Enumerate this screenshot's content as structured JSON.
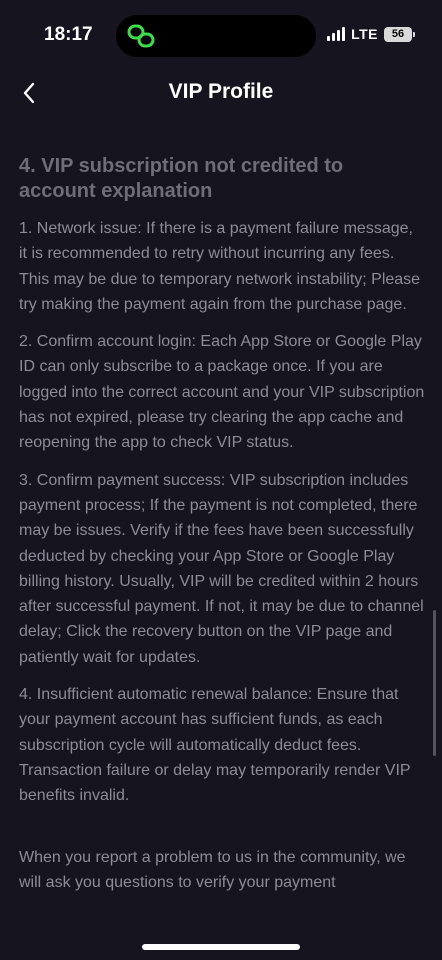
{
  "status_bar": {
    "time": "18:17",
    "network": "LTE",
    "battery": "56"
  },
  "header": {
    "title": "VIP Profile"
  },
  "section": {
    "heading": "4. VIP subscription not credited to account explanation",
    "paragraphs": [
      "1. Network issue: If there is a payment failure message, it is recommended to retry without incurring any fees. This may be due to temporary network instability; Please try making the payment again from the purchase page.",
      "2. Confirm account login: Each App Store or Google Play ID can only subscribe to a package once. If you are logged into the correct account and your VIP subscription has not expired, please try clearing the app cache and reopening the app to check VIP status.",
      "3. Confirm payment success: VIP subscription includes payment process; If the payment is not completed, there may be issues. Verify if the fees have been successfully deducted by checking your App Store or Google Play billing history. Usually, VIP will be credited within 2 hours after successful payment. If not, it may be due to channel delay; Click the recovery button on the VIP page and patiently wait for updates.",
      "4. Insufficient automatic renewal balance: Ensure that your payment account has sufficient funds, as each subscription cycle will automatically deduct fees. Transaction failure or delay may temporarily render VIP benefits invalid.",
      "When you report a problem to us in the community, we will ask you questions to verify your payment"
    ]
  },
  "colors": {
    "background": "#15141f",
    "accent_green": "#3ddc4a"
  },
  "icons": {
    "island": "link-icon",
    "back": "chevron-left-icon"
  }
}
